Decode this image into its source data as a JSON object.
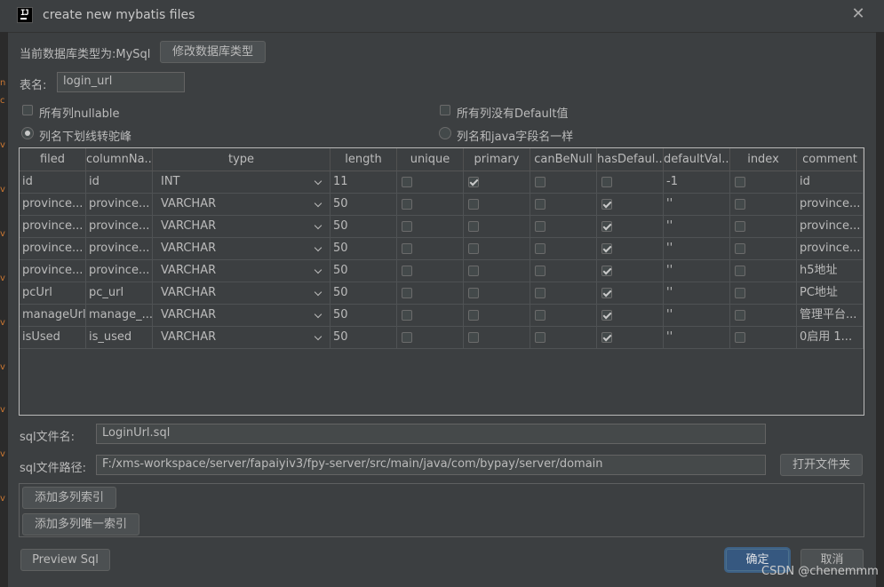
{
  "dialog": {
    "title": "create new mybatis files"
  },
  "db": {
    "type_label": "当前数据库类型为:MySql",
    "change_button": "修改数据库类型"
  },
  "table_name": {
    "label": "表名:",
    "value": "login_url"
  },
  "options": {
    "all_nullable": {
      "label": "所有列nullable",
      "checked": false
    },
    "no_default": {
      "label": "所有列没有Default值",
      "checked": false
    },
    "camel_case": {
      "label": "列名下划线转驼峰",
      "selected": true
    },
    "same_name": {
      "label": "列名和java字段名一样",
      "selected": false
    }
  },
  "columns": [
    "filed",
    "columnNa...",
    "type",
    "length",
    "unique",
    "primary",
    "canBeNull",
    "hasDefaul...",
    "defaultVal...",
    "index",
    "comment"
  ],
  "rows": [
    {
      "filed": "id",
      "column": "id",
      "type": "INT",
      "length": "11",
      "unique": false,
      "primary": true,
      "canBeNull": false,
      "hasDefault": false,
      "defaultVal": "-1",
      "index": false,
      "comment": "id"
    },
    {
      "filed": "province...",
      "column": "province...",
      "type": "VARCHAR",
      "length": "50",
      "unique": false,
      "primary": false,
      "canBeNull": false,
      "hasDefault": true,
      "defaultVal": "''",
      "index": false,
      "comment": "province..."
    },
    {
      "filed": "province...",
      "column": "province...",
      "type": "VARCHAR",
      "length": "50",
      "unique": false,
      "primary": false,
      "canBeNull": false,
      "hasDefault": true,
      "defaultVal": "''",
      "index": false,
      "comment": "province..."
    },
    {
      "filed": "province...",
      "column": "province...",
      "type": "VARCHAR",
      "length": "50",
      "unique": false,
      "primary": false,
      "canBeNull": false,
      "hasDefault": true,
      "defaultVal": "''",
      "index": false,
      "comment": "province..."
    },
    {
      "filed": "province...",
      "column": "province...",
      "type": "VARCHAR",
      "length": "50",
      "unique": false,
      "primary": false,
      "canBeNull": false,
      "hasDefault": true,
      "defaultVal": "''",
      "index": false,
      "comment": "h5地址"
    },
    {
      "filed": "pcUrl",
      "column": "pc_url",
      "type": "VARCHAR",
      "length": "50",
      "unique": false,
      "primary": false,
      "canBeNull": false,
      "hasDefault": true,
      "defaultVal": "''",
      "index": false,
      "comment": "PC地址"
    },
    {
      "filed": "manageUrl",
      "column": "manage_...",
      "type": "VARCHAR",
      "length": "50",
      "unique": false,
      "primary": false,
      "canBeNull": false,
      "hasDefault": true,
      "defaultVal": "''",
      "index": false,
      "comment": "管理平台..."
    },
    {
      "filed": "isUsed",
      "column": "is_used",
      "type": "VARCHAR",
      "length": "50",
      "unique": false,
      "primary": false,
      "canBeNull": false,
      "hasDefault": true,
      "defaultVal": "''",
      "index": false,
      "comment": "0启用 1..."
    }
  ],
  "sql_file": {
    "label": "sql文件名:",
    "value": "LoginUrl.sql"
  },
  "sql_path": {
    "label": "sql文件路径:",
    "value": "F:/xms-workspace/server/fapaiyiv3/fpy-server/src/main/java/com/bypay/server/domain",
    "open_button": "打开文件夹"
  },
  "index_buttons": {
    "add_multi_index": "添加多列索引",
    "add_multi_unique": "添加多列唯一索引"
  },
  "footer": {
    "preview": "Preview Sql",
    "ok": "确定",
    "cancel": "取消"
  },
  "watermark": "CSDN @chenemmm",
  "icons": {
    "app": "intellij-idea-icon",
    "close": "close-icon",
    "dropdown": "chevron-down-icon"
  },
  "colors": {
    "background": "#3c3f41",
    "primary_button": "#365880",
    "text": "#bbbbbb",
    "editor_keyword": "#cc7832"
  }
}
